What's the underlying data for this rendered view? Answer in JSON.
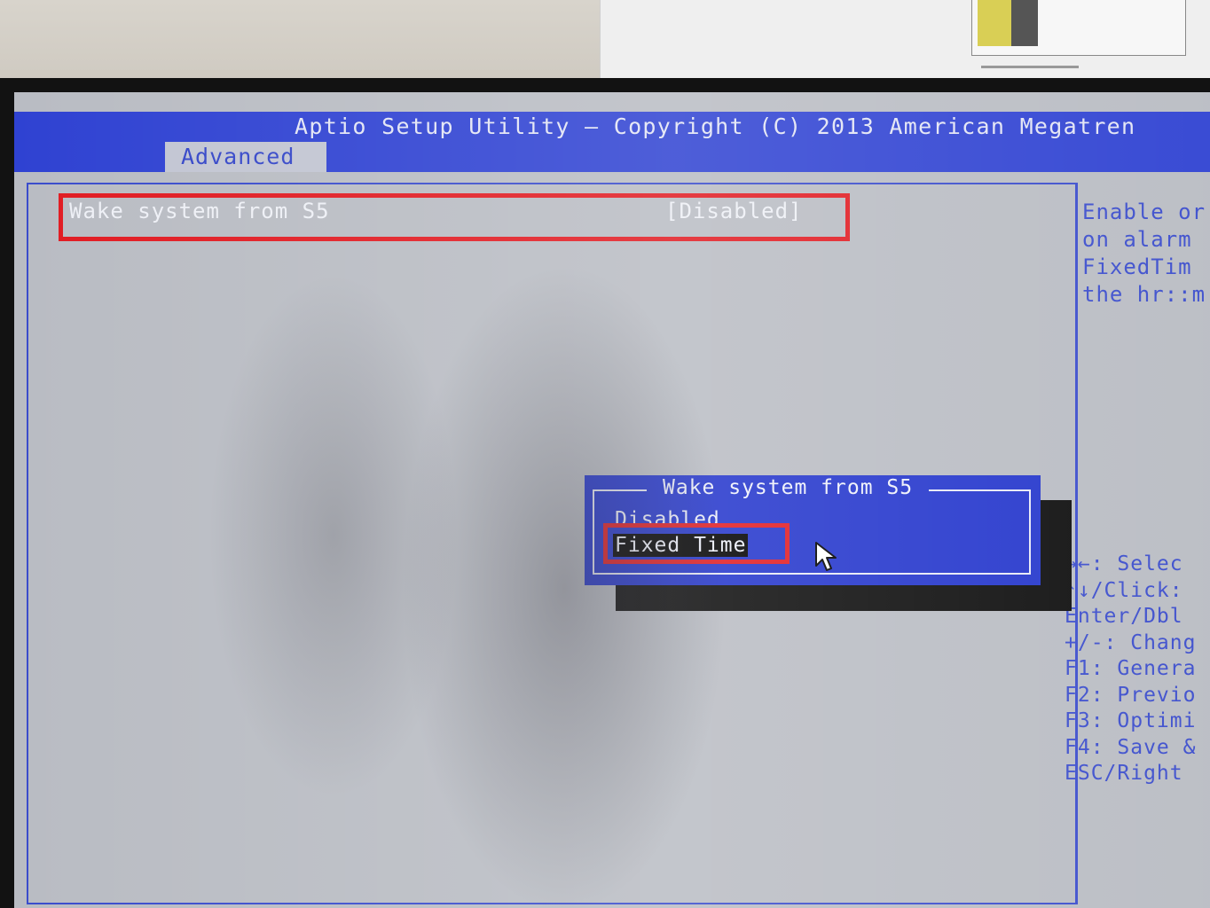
{
  "header": {
    "title": "Aptio Setup Utility – Copyright (C) 2013 American Megatren",
    "active_tab": "Advanced"
  },
  "settings": [
    {
      "label": "Wake system from S5",
      "value": "[Disabled]"
    }
  ],
  "help_text": [
    "Enable or",
    "on alarm",
    "FixedTim",
    "the hr::m"
  ],
  "key_help": [
    "→←: Selec",
    "↑↓/Click:",
    "Enter/Dbl",
    "+/-: Chang",
    "F1: Genera",
    "F2: Previo",
    "F3: Optimi",
    "F4: Save &",
    "ESC/Right"
  ],
  "popup": {
    "title": "Wake system from S5",
    "options": [
      "Disabled",
      "Fixed Time"
    ],
    "selected": "Fixed Time"
  },
  "colors": {
    "bios_blue": "#2f42d2",
    "panel_bg": "#b9bcc3",
    "annotation_red": "#e11b22"
  }
}
